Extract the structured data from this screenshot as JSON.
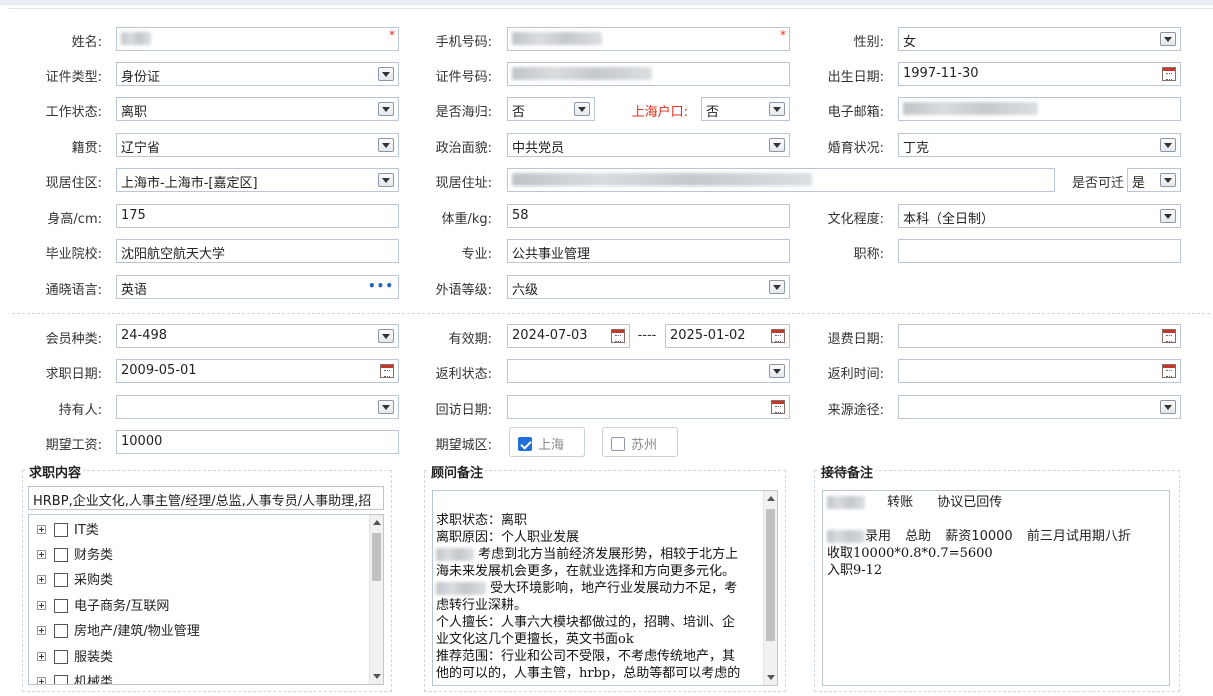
{
  "row1": {
    "name_label": "姓名:",
    "phone_label": "手机号码:",
    "gender_label": "性别:",
    "gender_value": "女",
    "required_mark": "*"
  },
  "row2": {
    "idtype_label": "证件类型:",
    "idtype_value": "身份证",
    "idno_label": "证件号码:",
    "birth_label": "出生日期:",
    "birth_value": "1997-11-30"
  },
  "row3": {
    "workstatus_label": "工作状态:",
    "workstatus_value": "离职",
    "returnee_label": "是否海归:",
    "returnee_value": "否",
    "hukou_label": "上海户口:",
    "hukou_value": "否",
    "email_label": "电子邮箱:"
  },
  "row4": {
    "native_label": "籍贯:",
    "native_value": "辽宁省",
    "political_label": "政治面貌:",
    "political_value": "中共党员",
    "marital_label": "婚育状况:",
    "marital_value": "丁克"
  },
  "row5": {
    "region_label": "现居住区:",
    "region_value": "上海市-上海市-[嘉定区]",
    "address_label": "现居住址:",
    "relocate_label": "是否可迁",
    "relocate_value": "是"
  },
  "row6": {
    "height_label": "身高/cm:",
    "height_value": "175",
    "weight_label": "体重/kg:",
    "weight_value": "58",
    "education_label": "文化程度:",
    "education_value": "本科（全日制）"
  },
  "row7": {
    "school_label": "毕业院校:",
    "school_value": "沈阳航空航天大学",
    "major_label": "专业:",
    "major_value": "公共事业管理",
    "title_label": "职称:",
    "title_value": ""
  },
  "row8": {
    "language_label": "通晓语言:",
    "language_value": "英语",
    "language_dots": "•••",
    "level_label": "外语等级:",
    "level_value": "六级"
  },
  "row9": {
    "member_label": "会员种类:",
    "member_value": "24-498",
    "valid_label": "有效期:",
    "valid_from": "2024-07-03",
    "valid_sep": "----",
    "valid_to": "2025-01-02",
    "refund_label": "退费日期:"
  },
  "row10": {
    "jobdate_label": "求职日期:",
    "jobdate_value": "2009-05-01",
    "rebate_status_label": "返利状态:",
    "rebate_time_label": "返利时间:"
  },
  "row11": {
    "holder_label": "持有人:",
    "visit_label": "回访日期:",
    "source_label": "来源途径:"
  },
  "row12": {
    "salary_label": "期望工资:",
    "salary_value": "10000",
    "city_label": "期望城区:",
    "city_options": [
      {
        "label": "上海",
        "checked": true
      },
      {
        "label": "苏州",
        "checked": false
      }
    ]
  },
  "job_content": {
    "legend": "求职内容",
    "summary": "HRBP,企业文化,人事主管/经理/总监,人事专员/人事助理,招",
    "tree": [
      "IT类",
      "财务类",
      "采购类",
      "电子商务/互联网",
      "房地产/建筑/物业管理",
      "服装类",
      "机械类"
    ]
  },
  "consultant_notes": {
    "legend": "顾问备注",
    "lines": [
      "求职状态：离职",
      "离职原因：个人职业发展",
      "考虑到北方当前经济发展形势，相较于北方上",
      "海未来发展机会更多，在就业选择和方向更多元化。",
      "受大环境影响，地产行业发展动力不足，考",
      "虑转行业深耕。",
      "个人擅长：人事六大模块都做过的，招聘、培训、企",
      "业文化这几个更擅长，英文书面ok",
      "推荐范围：行业和公司不受限，不考虑传统地产，其",
      "他的可以的，人事主管，hrbp，总助等都可以考虑的"
    ]
  },
  "reception_notes": {
    "legend": "接待备注",
    "line1_a": "转账",
    "line1_b": "协议已回传",
    "line2_a": "录用",
    "line2_b": "总助",
    "line2_c": "薪资10000",
    "line2_d": "前三月试用期八折",
    "line3": "收取10000*0.8*0.7=5600",
    "line4": "入职9-12"
  }
}
